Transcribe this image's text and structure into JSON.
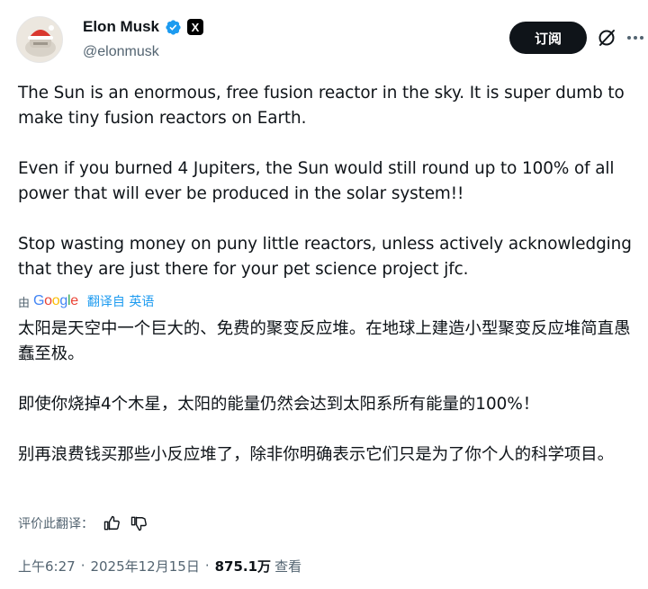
{
  "author": {
    "name": "Elon Musk",
    "handle": "@elonmusk",
    "badge_letter": "X",
    "verified_color": "#1d9bf0"
  },
  "actions": {
    "subscribe_label": "订阅",
    "grok_icon": "grok-slash-circle-icon",
    "more_icon": "more-dots-icon"
  },
  "tweet": {
    "paragraphs": [
      "The Sun is an enormous, free fusion reactor in the sky. It is super dumb to make tiny fusion reactors on Earth.",
      "Even if you burned 4 Jupiters, the Sun would still round up to 100% of all power that will ever be produced in the solar system!!",
      "Stop wasting money on puny little reactors, unless actively acknowledging that they are just there for your pet science project jfc."
    ]
  },
  "translation": {
    "by_label": "由",
    "provider": "Google",
    "link_label": "翻译自 英语",
    "paragraphs": [
      "太阳是天空中一个巨大的、免费的聚变反应堆。在地球上建造小型聚变反应堆简直愚蠢至极。",
      "即使你烧掉4个木星，太阳的能量仍然会达到太阳系所有能量的100%！",
      "别再浪费钱买那些小反应堆了，除非你明确表示它们只是为了你个人的科学项目。"
    ],
    "rate_label": "评价此翻译："
  },
  "meta": {
    "time": "上午6:27",
    "separator": "·",
    "date": "2025年12月15日",
    "views_count": "875.1万",
    "views_label": "查看"
  }
}
